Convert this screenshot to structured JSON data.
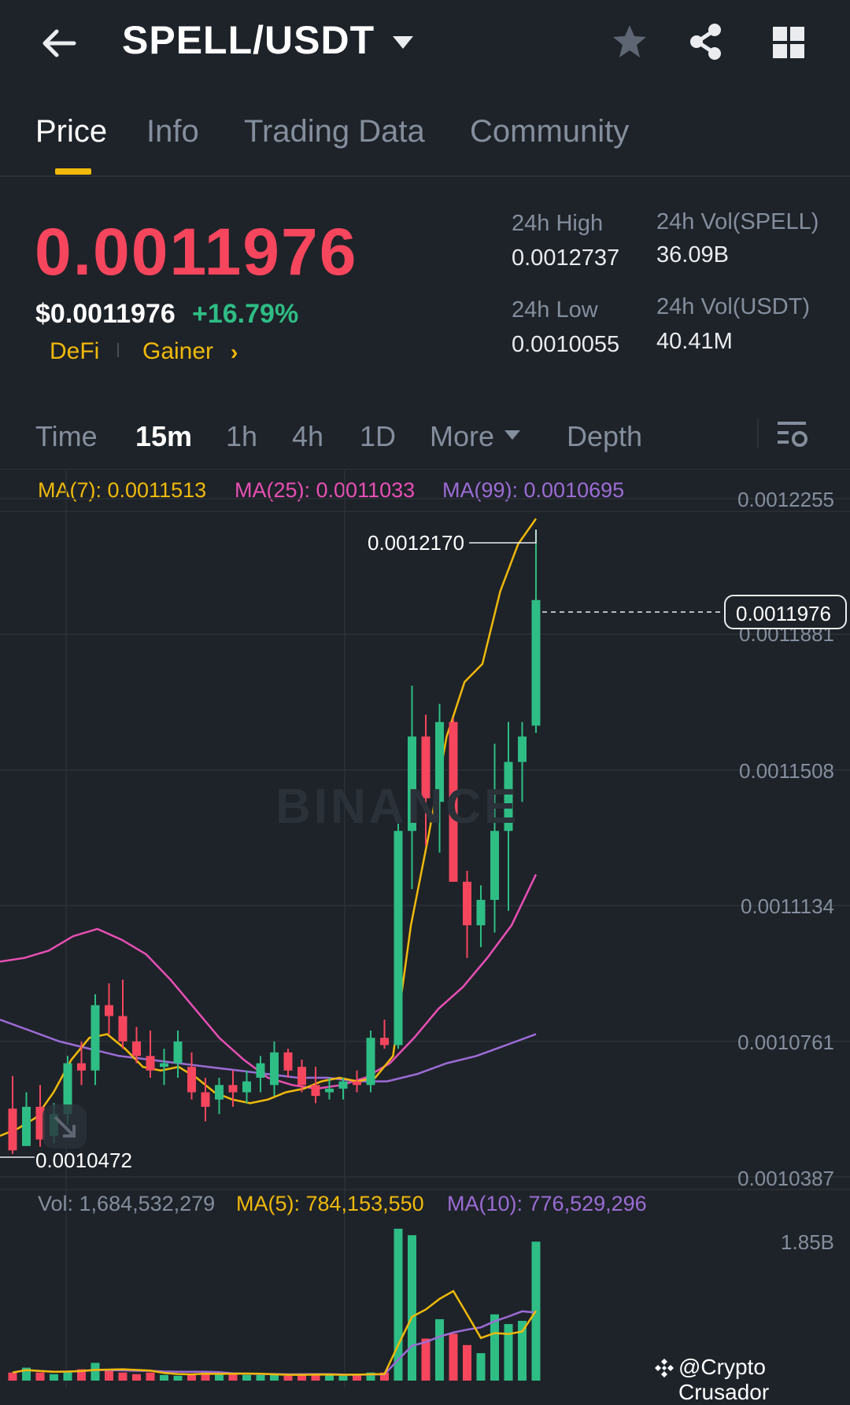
{
  "header": {
    "pair": "SPELL/USDT",
    "icons": [
      "back-arrow-icon",
      "caret-down-icon",
      "star-icon",
      "share-icon",
      "grid-icon"
    ]
  },
  "tabs": [
    {
      "label": "Price",
      "active": true
    },
    {
      "label": "Info",
      "active": false
    },
    {
      "label": "Trading Data",
      "active": false
    },
    {
      "label": "Community",
      "active": false
    }
  ],
  "price": {
    "last": "0.0011976",
    "usd": "$0.0011976",
    "change": "+16.79%",
    "tags": [
      "DeFi",
      "Gainer"
    ]
  },
  "stats": {
    "high_label": "24h High",
    "high_value": "0.0012737",
    "low_label": "24h Low",
    "low_value": "0.0010055",
    "vol_base_label": "24h Vol(SPELL)",
    "vol_base_value": "36.09B",
    "vol_quote_label": "24h Vol(USDT)",
    "vol_quote_value": "40.41M"
  },
  "intervals": {
    "items": [
      "Time",
      "15m",
      "1h",
      "4h",
      "1D",
      "More",
      "Depth"
    ],
    "active": "15m"
  },
  "ma_legend": {
    "ma7": "MA(7): 0.0011513",
    "ma25": "MA(25): 0.0011033",
    "ma99": "MA(99): 0.0010695"
  },
  "price_axis": [
    "0.0012255",
    "0.0011881",
    "0.0011508",
    "0.0011134",
    "0.0010761",
    "0.0010387"
  ],
  "markers": {
    "current": "0.0011976",
    "high": "0.0012170",
    "low": "0.0010472"
  },
  "watermark": "BINANCE",
  "volume": {
    "vol": "Vol: 1,684,532,279",
    "ma5": "MA(5): 784,153,550",
    "ma10": "MA(10): 776,529,296",
    "axis_top": "1.85B"
  },
  "attribution": "@Crypto Crusador",
  "colors": {
    "background": "#1e2329",
    "up": "#2ebd85",
    "down": "#f6465d",
    "accent": "#f0b90b",
    "ma7": "#f0b90b",
    "ma25": "#e84fb5",
    "ma99": "#9c6cd6",
    "muted": "#848e9c"
  },
  "chart_data": {
    "type": "candlestick",
    "interval": "15m",
    "price_range": [
      0.0010387,
      0.0012255
    ],
    "candles": [
      {
        "o": 0.0010575,
        "h": 0.0010665,
        "l": 0.001045,
        "c": 0.001046
      },
      {
        "o": 0.0010472,
        "h": 0.001062,
        "l": 0.0010472,
        "c": 0.001058
      },
      {
        "o": 0.001058,
        "h": 0.001064,
        "l": 0.001047,
        "c": 0.001049
      },
      {
        "o": 0.00105,
        "h": 0.001059,
        "l": 0.001048,
        "c": 0.001056
      },
      {
        "o": 0.001056,
        "h": 0.001072,
        "l": 0.001053,
        "c": 0.00107
      },
      {
        "o": 0.00107,
        "h": 0.001076,
        "l": 0.001064,
        "c": 0.001068
      },
      {
        "o": 0.001068,
        "h": 0.001089,
        "l": 0.001064,
        "c": 0.001086
      },
      {
        "o": 0.001086,
        "h": 0.001092,
        "l": 0.001078,
        "c": 0.001083
      },
      {
        "o": 0.001083,
        "h": 0.001093,
        "l": 0.001074,
        "c": 0.001076
      },
      {
        "o": 0.001076,
        "h": 0.00108,
        "l": 0.00107,
        "c": 0.001072
      },
      {
        "o": 0.001072,
        "h": 0.001079,
        "l": 0.001066,
        "c": 0.001068
      },
      {
        "o": 0.001069,
        "h": 0.001074,
        "l": 0.001064,
        "c": 0.00107
      },
      {
        "o": 0.00107,
        "h": 0.001079,
        "l": 0.001066,
        "c": 0.001076
      },
      {
        "o": 0.001069,
        "h": 0.001073,
        "l": 0.00106,
        "c": 0.001062
      },
      {
        "o": 0.001062,
        "h": 0.001066,
        "l": 0.001054,
        "c": 0.001058
      },
      {
        "o": 0.00106,
        "h": 0.001066,
        "l": 0.001056,
        "c": 0.001064
      },
      {
        "o": 0.001064,
        "h": 0.001068,
        "l": 0.001058,
        "c": 0.001062
      },
      {
        "o": 0.001062,
        "h": 0.001068,
        "l": 0.001059,
        "c": 0.001065
      },
      {
        "o": 0.001066,
        "h": 0.001072,
        "l": 0.001062,
        "c": 0.00107
      },
      {
        "o": 0.001064,
        "h": 0.001076,
        "l": 0.001061,
        "c": 0.001073
      },
      {
        "o": 0.001073,
        "h": 0.001074,
        "l": 0.001066,
        "c": 0.001068
      },
      {
        "o": 0.001069,
        "h": 0.001071,
        "l": 0.001062,
        "c": 0.001064
      },
      {
        "o": 0.001064,
        "h": 0.001069,
        "l": 0.001059,
        "c": 0.001061
      },
      {
        "o": 0.001062,
        "h": 0.001066,
        "l": 0.00106,
        "c": 0.001063
      },
      {
        "o": 0.001063,
        "h": 0.001066,
        "l": 0.00106,
        "c": 0.001065
      },
      {
        "o": 0.001065,
        "h": 0.001068,
        "l": 0.001062,
        "c": 0.001064
      },
      {
        "o": 0.001064,
        "h": 0.001079,
        "l": 0.001062,
        "c": 0.001077
      },
      {
        "o": 0.001077,
        "h": 0.001082,
        "l": 0.001074,
        "c": 0.001075
      },
      {
        "o": 0.001075,
        "h": 0.001136,
        "l": 0.001074,
        "c": 0.001134
      },
      {
        "o": 0.001134,
        "h": 0.001174,
        "l": 0.001118,
        "c": 0.00116
      },
      {
        "o": 0.00116,
        "h": 0.001166,
        "l": 0.00113,
        "c": 0.001143
      },
      {
        "o": 0.001142,
        "h": 0.001169,
        "l": 0.001128,
        "c": 0.001164
      },
      {
        "o": 0.001164,
        "h": 0.001165,
        "l": 0.00112,
        "c": 0.00112
      },
      {
        "o": 0.00112,
        "h": 0.001123,
        "l": 0.001099,
        "c": 0.001108
      },
      {
        "o": 0.001108,
        "h": 0.001119,
        "l": 0.001102,
        "c": 0.001115
      },
      {
        "o": 0.001115,
        "h": 0.001158,
        "l": 0.001106,
        "c": 0.001134
      },
      {
        "o": 0.001134,
        "h": 0.001164,
        "l": 0.001112,
        "c": 0.001153
      },
      {
        "o": 0.001153,
        "h": 0.001164,
        "l": 0.001142,
        "c": 0.00116
      },
      {
        "o": 0.001163,
        "h": 0.001217,
        "l": 0.001161,
        "c": 0.0011976
      }
    ],
    "ma7": [
      0.00105,
      0.001052,
      0.001055,
      0.001062,
      0.001071,
      0.001077,
      0.001078,
      0.001074,
      0.001069,
      0.001068,
      0.001069,
      0.001066,
      0.001062,
      0.00106,
      0.001059,
      0.00106,
      0.001062,
      0.001063,
      0.001065,
      0.001066,
      0.001065,
      0.001066,
      0.001072,
      0.001108,
      0.001133,
      0.00116,
      0.001175,
      0.00118,
      0.0012,
      0.001213,
      0.00122
    ],
    "ma25": [
      0.001098,
      0.001099,
      0.001101,
      0.001105,
      0.001107,
      0.001104,
      0.0011,
      0.001093,
      0.001085,
      0.001077,
      0.001071,
      0.001066,
      0.001064,
      0.001063,
      0.001064,
      0.001066,
      0.00107,
      0.001077,
      0.001085,
      0.001091,
      0.001099,
      0.001108,
      0.001122
    ],
    "ma99": [
      0.001082,
      0.001079,
      0.001076,
      0.001074,
      0.001072,
      0.001071,
      0.00107,
      0.001069,
      0.001068,
      0.001067,
      0.001066,
      0.001066,
      0.001065,
      0.001065,
      0.001067,
      0.00107,
      0.001072,
      0.001075,
      0.001078
    ],
    "volume_range": [
      0,
      1.85
    ],
    "volume_unit": "B",
    "volumes": [
      0.1,
      0.16,
      0.1,
      0.08,
      0.12,
      0.14,
      0.22,
      0.12,
      0.1,
      0.08,
      0.1,
      0.07,
      0.06,
      0.08,
      0.12,
      0.09,
      0.08,
      0.07,
      0.07,
      0.08,
      0.06,
      0.08,
      0.08,
      0.08,
      0.06,
      0.07,
      0.1,
      0.1,
      1.88,
      1.8,
      0.52,
      0.76,
      0.58,
      0.44,
      0.34,
      0.82,
      0.7,
      0.74,
      1.72
    ]
  }
}
